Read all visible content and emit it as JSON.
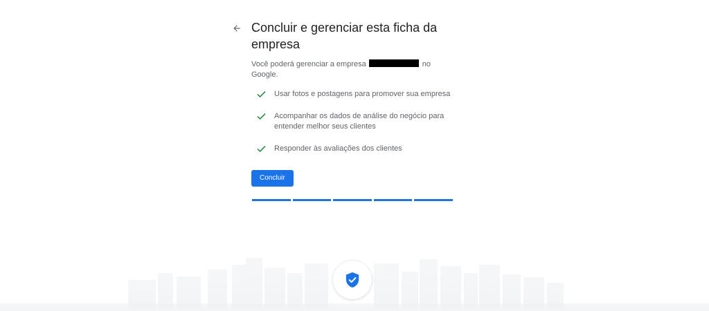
{
  "header": {
    "back_icon": "arrow-back-icon",
    "title": "Concluir e gerenciar esta ficha da empresa"
  },
  "description": {
    "prefix": "Você poderá gerenciar a empresa",
    "suffix": "no Google."
  },
  "features": [
    {
      "icon": "check-icon",
      "text": "Usar fotos e postagens para promover sua empresa"
    },
    {
      "icon": "check-icon",
      "text": "Acompanhar os dados de análise do negócio para entender melhor seus clientes"
    },
    {
      "icon": "check-icon",
      "text": "Responder às avaliações dos clientes"
    }
  ],
  "actions": {
    "done_label": "Concluir"
  },
  "progress": {
    "steps_total": 5,
    "steps_completed": 5
  },
  "badge": {
    "icon": "verified-shield-icon"
  },
  "colors": {
    "accent": "#1a73e8",
    "check": "#188038",
    "title": "#202124",
    "body_text": "#5f6368"
  }
}
